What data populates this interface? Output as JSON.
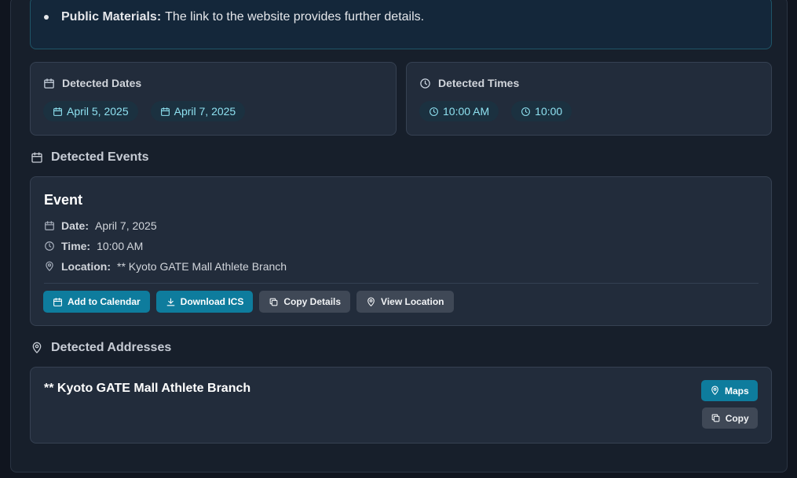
{
  "summary": {
    "bullet_label": "Public Materials:",
    "bullet_text": "The link to the website provides further details."
  },
  "detected_dates": {
    "title": "Detected Dates",
    "items": [
      "April 5, 2025",
      "April 7, 2025"
    ]
  },
  "detected_times": {
    "title": "Detected Times",
    "items": [
      "10:00 AM",
      "10:00"
    ]
  },
  "events_section": {
    "heading": "Detected Events",
    "event": {
      "title": "Event",
      "date_label": "Date:",
      "date_value": "April 7, 2025",
      "time_label": "Time:",
      "time_value": "10:00 AM",
      "location_label": "Location:",
      "location_value": "** Kyoto GATE Mall Athlete Branch"
    },
    "buttons": {
      "add_calendar": "Add to Calendar",
      "download_ics": "Download ICS",
      "copy_details": "Copy Details",
      "view_location": "View Location"
    }
  },
  "addresses_section": {
    "heading": "Detected Addresses",
    "address": "** Kyoto GATE Mall Athlete Branch",
    "maps_button": "Maps",
    "copy_button": "Copy"
  },
  "colors": {
    "accent": "#0e7c9d",
    "chip_text": "#8ee1f0",
    "card_bg": "#222c3b"
  },
  "icons": {
    "calendar": "calendar-icon",
    "clock": "clock-icon",
    "map_pin": "map-pin-icon",
    "download": "download-icon",
    "copy": "copy-icon"
  }
}
